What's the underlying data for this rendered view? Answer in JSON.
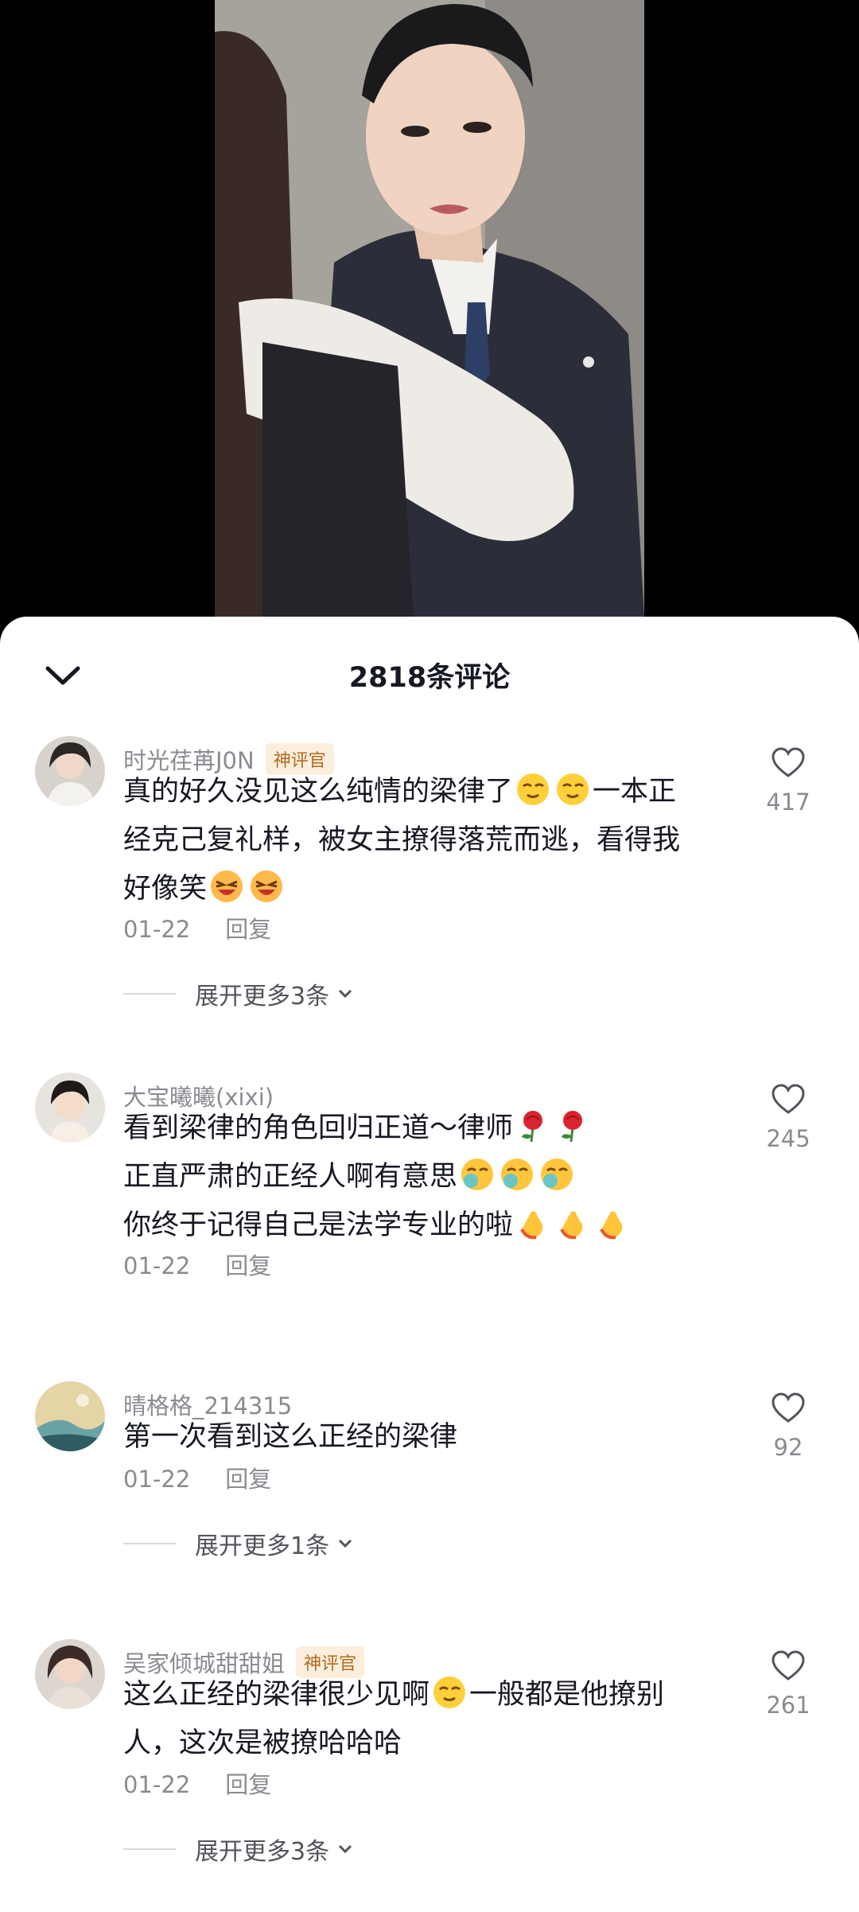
{
  "sheet": {
    "title": "2818条评论"
  },
  "comments": [
    {
      "username": "时光荏苒J0N",
      "badge": "神评官",
      "lines": [
        "真的好久没见这么纯情的梁律了",
        "经克己复礼样，被女主撩得落荒而逃，看得我",
        "好像笑"
      ],
      "line1_after": "一本正",
      "date": "01-22",
      "reply": "回复",
      "likes": "417",
      "expand": "展开更多3条"
    },
    {
      "username": "大宝曦曦(xixi)",
      "lines": [
        "看到梁律的角色回归正道～律师",
        "正直严肃的正经人啊有意思",
        "你终于记得自己是法学专业的啦"
      ],
      "date": "01-22",
      "reply": "回复",
      "likes": "245"
    },
    {
      "username": "晴格格_214315",
      "lines": [
        "第一次看到这么正经的梁律"
      ],
      "date": "01-22",
      "reply": "回复",
      "likes": "92",
      "expand": "展开更多1条"
    },
    {
      "username": "吴家倾城甜甜姐",
      "badge": "神评官",
      "lines": [
        "这么正经的梁律很少见啊",
        "人，这次是被撩哈哈哈"
      ],
      "line1_after": "一般都是他撩别",
      "date": "01-22",
      "reply": "回复",
      "likes": "261",
      "expand": "展开更多3条"
    }
  ],
  "icons": {
    "collapse": "chevron-down-icon",
    "like": "heart-outline-icon",
    "expand": "chevron-down-small-icon"
  },
  "colors": {
    "badge_bg": "#fbeedd",
    "badge_text": "#b36a1d",
    "secondary_text": "#8a8b91"
  }
}
